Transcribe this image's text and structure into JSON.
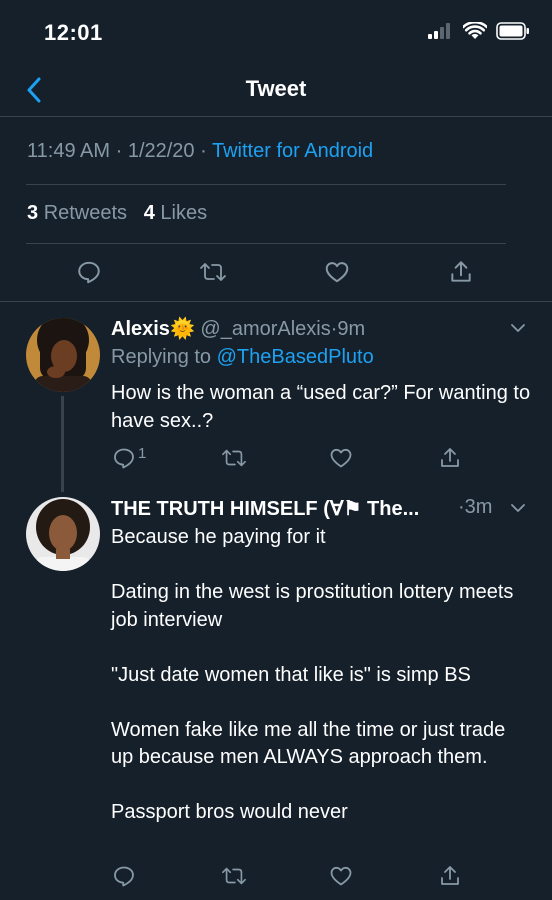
{
  "status_bar": {
    "time": "12:01"
  },
  "nav": {
    "title": "Tweet"
  },
  "tweet_meta": {
    "time": "11:49 AM",
    "sep1": "·",
    "date": "1/22/20",
    "sep2": "·",
    "source": "Twitter for Android"
  },
  "stats": {
    "retweets_count": "3",
    "retweets_label": "Retweets",
    "likes_count": "4",
    "likes_label": "Likes"
  },
  "reply1": {
    "name": "Alexis",
    "emoji": "🌞",
    "handle": "@_amorAlexis",
    "sep": "·",
    "time": "9m",
    "replying_prefix": "Replying to",
    "replying_to": "@TheBasedPluto",
    "text": "How is the woman a “used car?” For wanting to have sex..?",
    "reply_count": "1"
  },
  "reply2": {
    "name": "THE TRUTH HIMSELF (∀⚑ The...",
    "sep": "·",
    "time": "3m",
    "paragraphs": [
      "Because he paying for it",
      "Dating in the west is prostitution lottery meets job interview",
      "\"Just date women that like is\" is simp BS",
      "Women fake like me all the time or just trade up because men ALWAYS approach them.",
      "Passport bros would never"
    ]
  },
  "colors": {
    "background": "#15202b",
    "accent": "#1da1f2",
    "muted": "#8899a6",
    "divider": "#38444d"
  }
}
